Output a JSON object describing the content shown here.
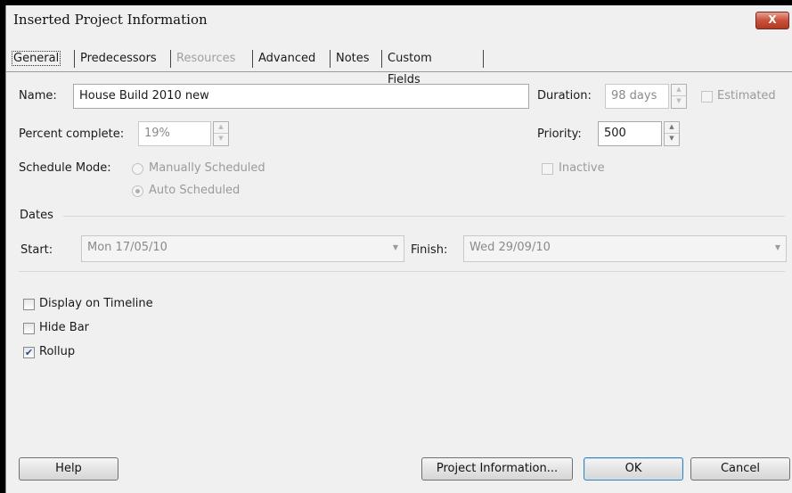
{
  "window": {
    "title": "Inserted Project Information",
    "close_label": "X"
  },
  "tabs": [
    {
      "label": "General",
      "active": true,
      "enabled": true
    },
    {
      "label": "Predecessors",
      "active": false,
      "enabled": true
    },
    {
      "label": "Resources",
      "active": false,
      "enabled": false
    },
    {
      "label": "Advanced",
      "active": false,
      "enabled": true
    },
    {
      "label": "Notes",
      "active": false,
      "enabled": true
    },
    {
      "label": "Custom Fields",
      "active": false,
      "enabled": true
    }
  ],
  "fields": {
    "name_label": "Name:",
    "name_value": "House Build 2010 new",
    "duration_label": "Duration:",
    "duration_value": "98 days",
    "estimated_label": "Estimated",
    "percent_label": "Percent complete:",
    "percent_value": "19%",
    "priority_label": "Priority:",
    "priority_value": "500",
    "schedule_label": "Schedule Mode:",
    "manual_label": "Manually Scheduled",
    "auto_label": "Auto Scheduled",
    "inactive_label": "Inactive"
  },
  "dates": {
    "section_label": "Dates",
    "start_label": "Start:",
    "start_value": "Mon 17/05/10",
    "finish_label": "Finish:",
    "finish_value": "Wed 29/09/10"
  },
  "options": [
    {
      "label": "Display on Timeline",
      "checked": false
    },
    {
      "label": "Hide Bar",
      "checked": false
    },
    {
      "label": "Rollup",
      "checked": true
    }
  ],
  "buttons": {
    "help": "Help",
    "project_info": "Project Information...",
    "ok": "OK",
    "cancel": "Cancel"
  },
  "colors": {
    "dialog_bg": "#f0f0f0",
    "close_red": "#c9503a",
    "check_blue": "#2a4c9a"
  }
}
